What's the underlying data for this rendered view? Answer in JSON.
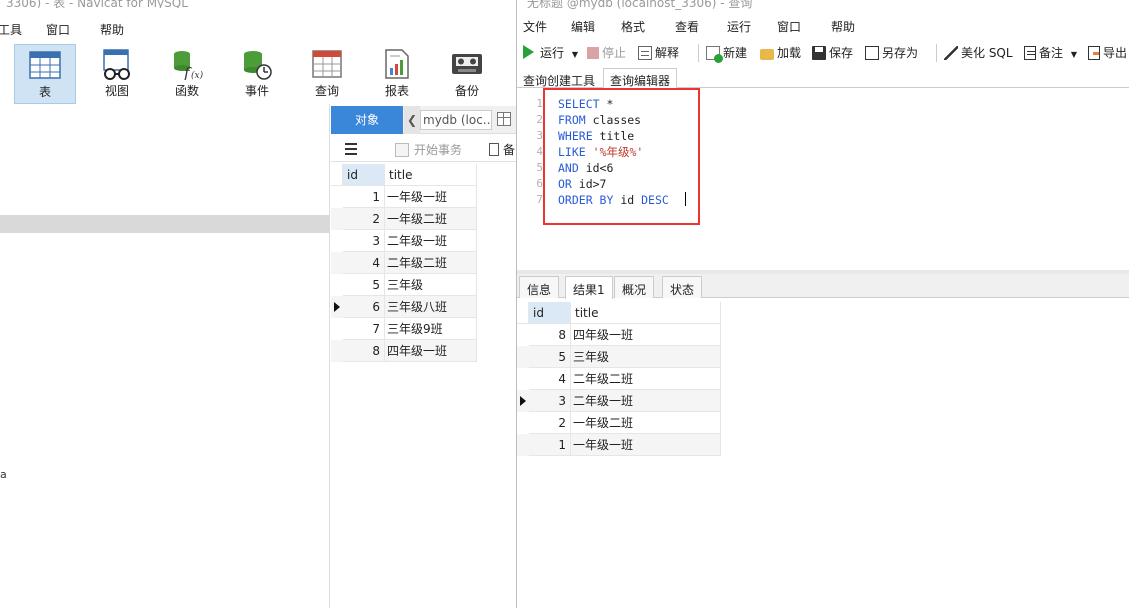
{
  "back_window": {
    "title": "_3306) - 表 - Navicat for MySQL",
    "menu": [
      "工具",
      "窗口",
      "帮助"
    ],
    "toolbar": [
      {
        "label": "表",
        "icon": "table-icon",
        "active": true
      },
      {
        "label": "视图",
        "icon": "view-icon",
        "active": false
      },
      {
        "label": "函数",
        "icon": "function-icon",
        "active": false
      },
      {
        "label": "事件",
        "icon": "event-icon",
        "active": false
      },
      {
        "label": "查询",
        "icon": "query-icon",
        "active": false
      },
      {
        "label": "报表",
        "icon": "report-icon",
        "active": false
      },
      {
        "label": "备份",
        "icon": "backup-icon",
        "active": false
      }
    ],
    "left_fragment": "a",
    "object_tab": "对象",
    "db_selector": "mydb (loc...",
    "begin_transaction": "开始事务",
    "cut_label": "备",
    "table": {
      "columns": [
        "id",
        "title"
      ],
      "rows": [
        [
          "1",
          "一年级一班"
        ],
        [
          "2",
          "一年级二班"
        ],
        [
          "3",
          "二年级一班"
        ],
        [
          "4",
          "二年级二班"
        ],
        [
          "5",
          "三年级"
        ],
        [
          "6",
          "三年级八班"
        ],
        [
          "7",
          "三年级9班"
        ],
        [
          "8",
          "四年级一班"
        ]
      ],
      "current_row": 5
    }
  },
  "front_window": {
    "title": "无标题 @mydb (localhost_3306) - 查询",
    "menu": [
      "文件",
      "编辑",
      "格式",
      "查看",
      "运行",
      "窗口",
      "帮助"
    ],
    "toolbar": {
      "run": "运行",
      "stop": "停止",
      "explain": "解释",
      "new": "新建",
      "load": "加载",
      "save": "保存",
      "save_as": "另存为",
      "beautify": "美化 SQL",
      "comment": "备注",
      "export": "导出"
    },
    "tabs": [
      "查询创建工具",
      "查询编辑器"
    ],
    "active_tab": 1,
    "sql_lines": [
      {
        "n": "1",
        "kw": "SELECT",
        "rest": " *"
      },
      {
        "n": "2",
        "kw": "FROM",
        "rest": " classes"
      },
      {
        "n": "3",
        "kw": "WHERE",
        "rest": " title"
      },
      {
        "n": "4",
        "kw": "LIKE",
        "rest": " ",
        "str": "'%年级%'"
      },
      {
        "n": "5",
        "kw": "AND",
        "rest": " id<6"
      },
      {
        "n": "6",
        "kw": "OR",
        "rest": " id>7"
      },
      {
        "n": "7",
        "kw": "ORDER BY",
        "rest": " id ",
        "kw2": "DESC"
      }
    ],
    "result_tabs": [
      "信息",
      "结果1",
      "概况",
      "状态"
    ],
    "active_result_tab": 1,
    "result": {
      "columns": [
        "id",
        "title"
      ],
      "rows": [
        [
          "8",
          "四年级一班"
        ],
        [
          "5",
          "三年级"
        ],
        [
          "4",
          "二年级二班"
        ],
        [
          "3",
          "二年级一班"
        ],
        [
          "2",
          "一年级二班"
        ],
        [
          "1",
          "一年级一班"
        ]
      ],
      "current_row": 3
    }
  },
  "colors": {
    "accent": "#3a86d8",
    "highlight_box": "#e33333",
    "keyword": "#2a5bd7",
    "string": "#c0392b"
  }
}
